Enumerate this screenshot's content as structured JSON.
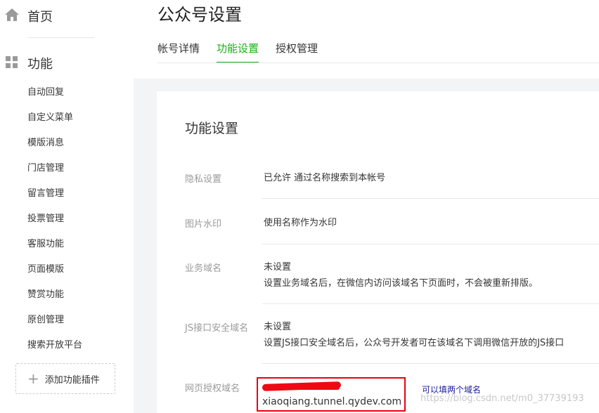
{
  "sidebar": {
    "home_label": "首页",
    "section_label": "功能",
    "items": [
      {
        "label": "自动回复"
      },
      {
        "label": "自定义菜单"
      },
      {
        "label": "模版消息"
      },
      {
        "label": "门店管理"
      },
      {
        "label": "留言管理"
      },
      {
        "label": "投票管理"
      },
      {
        "label": "客服功能"
      },
      {
        "label": "页面模版"
      },
      {
        "label": "赞赏功能"
      },
      {
        "label": "原创管理"
      },
      {
        "label": "搜索开放平台"
      }
    ],
    "add_plugin_label": "添加功能插件"
  },
  "header": {
    "title": "公众号设置",
    "tabs": [
      {
        "label": "帐号详情"
      },
      {
        "label": "功能设置"
      },
      {
        "label": "授权管理"
      }
    ],
    "active_tab": "功能设置"
  },
  "panel": {
    "title": "功能设置",
    "rows": [
      {
        "label": "隐私设置",
        "value": "已允许 通过名称搜索到本帐号"
      },
      {
        "label": "图片水印",
        "value": "使用名称作为水印"
      },
      {
        "label": "业务域名",
        "value": "未设置",
        "desc": "设置业务域名后，在微信内访问该域名下页面时，不会被重新排版。"
      },
      {
        "label": "JS接口安全域名",
        "value": "未设置",
        "desc": "设置JS接口安全域名后，公众号开发者可在该域名下调用微信开放的JS接口"
      },
      {
        "label": "网页授权域名",
        "value": "xiaoqiang.tunnel.qydev.com"
      }
    ],
    "annotation": "可以填两个域名"
  },
  "watermark": "https://blog.csdn.net/m0_37739193",
  "colors": {
    "accent": "#1aad19",
    "highlight_red": "#e8000f",
    "annotation_blue": "#1c1c9c"
  },
  "icons": {
    "home": "home-icon",
    "function": "grid-icon",
    "add": "plus-icon"
  }
}
